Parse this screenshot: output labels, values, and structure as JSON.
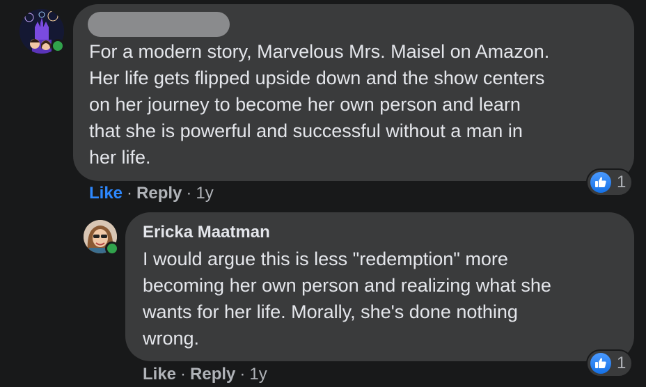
{
  "colors": {
    "background": "#18191a",
    "bubble": "#3a3b3c",
    "text": "#e4e6eb",
    "secondary_text": "#b0b3b8",
    "like_blue": "#2d88ff",
    "online_green": "#31a24c"
  },
  "comments": [
    {
      "author": "",
      "author_redacted": true,
      "text": "For a modern story, Marvelous Mrs. Maisel on Amazon.\nHer life gets flipped upside down and the show centers\non her journey to become her own person and learn\nthat she is powerful and successful without a man in\nher life.",
      "like_label": "Like",
      "reply_label": "Reply",
      "time": "1y",
      "reaction_icon": "thumbs-up-icon",
      "reaction_count": "1"
    },
    {
      "author": "Ericka Maatman",
      "text": "I would argue this is less \"redemption\" more\nbecoming her own person and realizing what she\nwants for her life. Morally, she's done nothing\nwrong.",
      "like_label": "Like",
      "reply_label": "Reply",
      "time": "1y",
      "reaction_icon": "thumbs-up-icon",
      "reaction_count": "1"
    }
  ]
}
